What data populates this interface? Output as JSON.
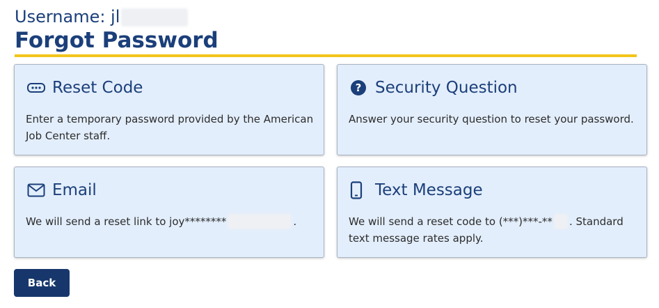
{
  "header": {
    "username_label": "Username: jl",
    "title": "Forgot Password"
  },
  "options": {
    "reset_code": {
      "title": "Reset Code",
      "description": "Enter a temporary password provided by the American Job Center staff.",
      "icon": "password-dots-icon"
    },
    "security_question": {
      "title": "Security Question",
      "description": "Answer your security question to reset your password.",
      "icon": "question-circle-icon"
    },
    "email": {
      "title": "Email",
      "description_prefix": "We will send a reset link to joy********",
      "description_suffix": ".",
      "icon": "envelope-icon"
    },
    "text_message": {
      "title": "Text Message",
      "description_prefix": "We will send a reset code to (***)***-**",
      "description_suffix": ". Standard text message rates apply.",
      "icon": "mobile-phone-icon"
    }
  },
  "footer": {
    "back_label": "Back"
  },
  "colors": {
    "primary": "#1b3f7a",
    "accent_rule": "#f2c519",
    "card_background": "#e3eefc",
    "button_background": "#17376c"
  }
}
